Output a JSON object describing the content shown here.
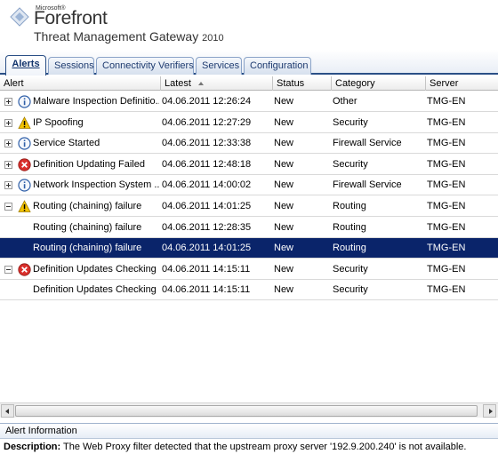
{
  "brand": {
    "vendor": "Microsoft®",
    "product": "Forefront",
    "subtitle": "Threat Management Gateway",
    "year": "2010"
  },
  "tabs": [
    {
      "label": "Alerts",
      "active": true
    },
    {
      "label": "Sessions",
      "active": false
    },
    {
      "label": "Connectivity Verifiers",
      "active": false
    },
    {
      "label": "Services",
      "active": false
    },
    {
      "label": "Configuration",
      "active": false
    }
  ],
  "grid": {
    "columns": [
      "Alert",
      "Latest",
      "Status",
      "Category",
      "Server"
    ],
    "sorted_column": "Latest",
    "rows": [
      {
        "expander": "plus",
        "icon": "info-icon",
        "alert": "Malware Inspection Definitio...",
        "latest": "04.06.2011 12:26:24",
        "status": "New",
        "category": "Other",
        "server": "TMG-EN"
      },
      {
        "expander": "plus",
        "icon": "warning-icon",
        "alert": "IP Spoofing",
        "latest": "04.06.2011 12:27:29",
        "status": "New",
        "category": "Security",
        "server": "TMG-EN"
      },
      {
        "expander": "plus",
        "icon": "info-icon",
        "alert": "Service Started",
        "latest": "04.06.2011 12:33:38",
        "status": "New",
        "category": "Firewall Service",
        "server": "TMG-EN"
      },
      {
        "expander": "plus",
        "icon": "error-icon",
        "alert": "Definition Updating Failed",
        "latest": "04.06.2011 12:48:18",
        "status": "New",
        "category": "Security",
        "server": "TMG-EN"
      },
      {
        "expander": "plus",
        "icon": "info-icon",
        "alert": "Network Inspection System ...",
        "latest": "04.06.2011 14:00:02",
        "status": "New",
        "category": "Firewall Service",
        "server": "TMG-EN"
      },
      {
        "expander": "minus",
        "icon": "warning-icon",
        "alert": "Routing (chaining) failure",
        "latest": "04.06.2011 14:01:25",
        "status": "New",
        "category": "Routing",
        "server": "TMG-EN"
      },
      {
        "expander": "none",
        "icon": "none",
        "alert": "Routing (chaining) failure",
        "latest": "04.06.2011 12:28:35",
        "status": "New",
        "category": "Routing",
        "server": "TMG-EN"
      },
      {
        "expander": "none",
        "icon": "none",
        "alert": "Routing (chaining) failure",
        "latest": "04.06.2011 14:01:25",
        "status": "New",
        "category": "Routing",
        "server": "TMG-EN",
        "selected": true
      },
      {
        "expander": "minus",
        "icon": "error-icon",
        "alert": "Definition Updates Checking ...",
        "latest": "04.06.2011 14:15:11",
        "status": "New",
        "category": "Security",
        "server": "TMG-EN"
      },
      {
        "expander": "none",
        "icon": "none",
        "alert": "Definition Updates Checking ...",
        "latest": "04.06.2011 14:15:11",
        "status": "New",
        "category": "Security",
        "server": "TMG-EN"
      }
    ]
  },
  "info": {
    "title": "Alert Information",
    "description_label": "Description:",
    "description_text": " The Web Proxy filter detected that the upstream proxy server '192.9.200.240' is not available."
  },
  "colors": {
    "selection": "#0a246a",
    "tab_border": "#2a4f86",
    "error": "#d9302c",
    "warning": "#f2c200",
    "info": "#2f5fa8"
  }
}
